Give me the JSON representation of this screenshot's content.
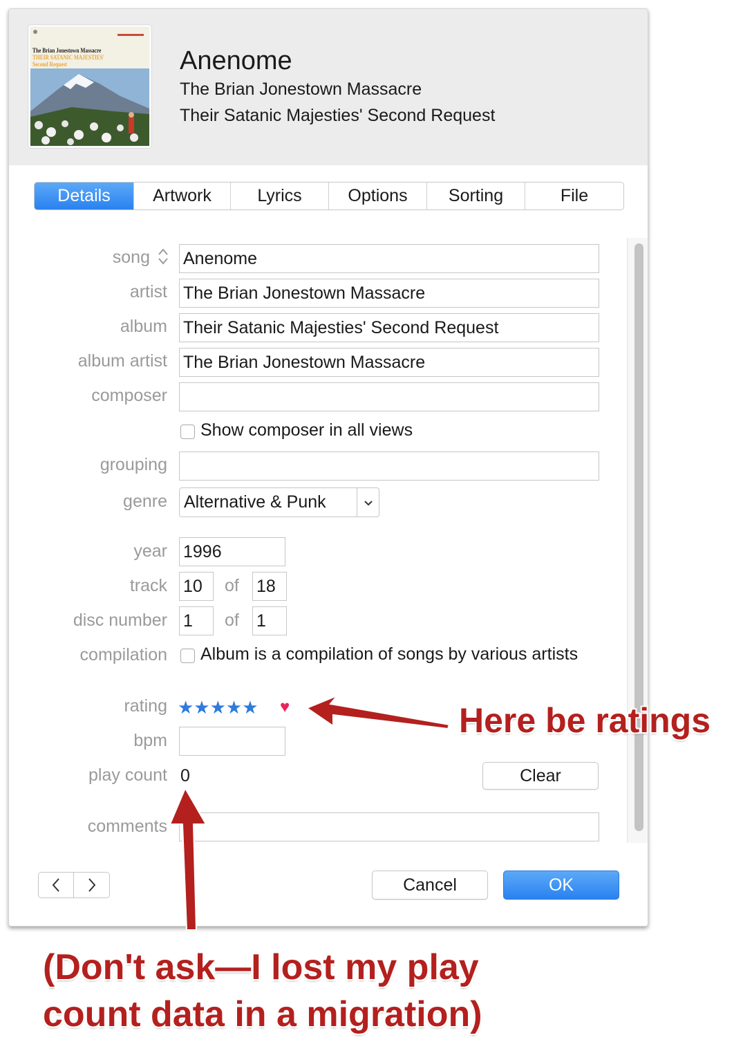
{
  "header": {
    "title": "Anenome",
    "artist": "The Brian Jonestown Massacre",
    "album": "Their Satanic Majesties' Second Request",
    "cover": {
      "line1": "The Brian Jonestown Massacre",
      "line2": "THEIR SATANIC MAJESTIES'",
      "line3": "Second Request"
    }
  },
  "tabs": [
    {
      "label": "Details",
      "active": true
    },
    {
      "label": "Artwork"
    },
    {
      "label": "Lyrics"
    },
    {
      "label": "Options"
    },
    {
      "label": "Sorting"
    },
    {
      "label": "File"
    }
  ],
  "form": {
    "song": {
      "label": "song",
      "value": "Anenome"
    },
    "artist": {
      "label": "artist",
      "value": "The Brian Jonestown Massacre"
    },
    "album": {
      "label": "album",
      "value": "Their Satanic Majesties' Second Request"
    },
    "album_artist": {
      "label": "album artist",
      "value": "The Brian Jonestown Massacre"
    },
    "composer": {
      "label": "composer",
      "value": ""
    },
    "show_composer": {
      "label": "Show composer in all views",
      "checked": false
    },
    "grouping": {
      "label": "grouping",
      "value": ""
    },
    "genre": {
      "label": "genre",
      "value": "Alternative & Punk"
    },
    "year": {
      "label": "year",
      "value": "1996"
    },
    "track": {
      "label": "track",
      "value": "10",
      "of_label": "of",
      "total": "18"
    },
    "disc": {
      "label": "disc number",
      "value": "1",
      "of_label": "of",
      "total": "1"
    },
    "compilation": {
      "label": "compilation",
      "checkbox_label": "Album is a compilation of songs by various artists",
      "checked": false
    },
    "rating": {
      "label": "rating",
      "stars": "★★★★★",
      "value": 5,
      "max": 5,
      "loved": true,
      "love_glyph": "♥"
    },
    "bpm": {
      "label": "bpm",
      "value": ""
    },
    "play_count": {
      "label": "play count",
      "value": "0",
      "clear_label": "Clear"
    },
    "comments": {
      "label": "comments",
      "value": ""
    }
  },
  "footer": {
    "cancel_label": "Cancel",
    "ok_label": "OK"
  },
  "annotations": {
    "ratings_note": "Here be ratings",
    "playcount_note_line1": "(Don't ask—I lost my play",
    "playcount_note_line2": "count data in a migration)"
  },
  "colors": {
    "accent": "#2a82f0",
    "star": "#2e7bdc",
    "heart": "#e8245a",
    "annotation": "#b3201e",
    "header_bg": "#ececec"
  },
  "icons": [
    "sort-arrows-icon",
    "chevron-down-icon",
    "chevron-left-icon",
    "chevron-right-icon",
    "heart-icon",
    "star-icon"
  ]
}
